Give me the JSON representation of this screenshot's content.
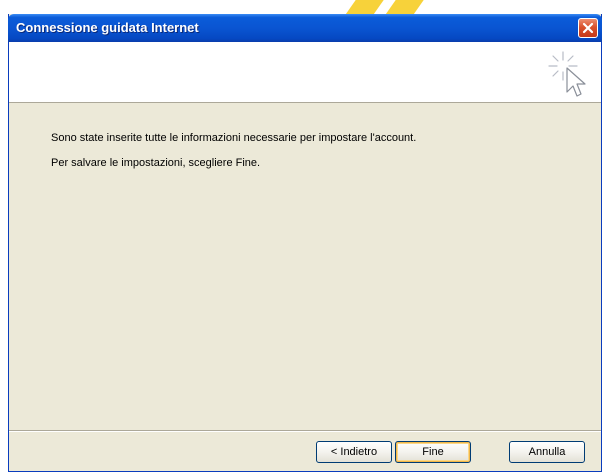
{
  "window": {
    "title": "Connessione guidata Internet"
  },
  "content": {
    "line1": "Sono state inserite tutte le informazioni necessarie per impostare l'account.",
    "line2": "Per salvare le impostazioni, scegliere Fine."
  },
  "buttons": {
    "back_label": "< Indietro",
    "finish_label": "Fine",
    "cancel_label": "Annulla"
  },
  "icons": {
    "close": "close-icon",
    "wizard": "cursor-sparkle-icon"
  },
  "colors": {
    "titlebar": "#0a55d2",
    "close_button": "#d9512d",
    "dialog_background": "#ece9d8",
    "default_button_highlight": "#f1b74a"
  }
}
